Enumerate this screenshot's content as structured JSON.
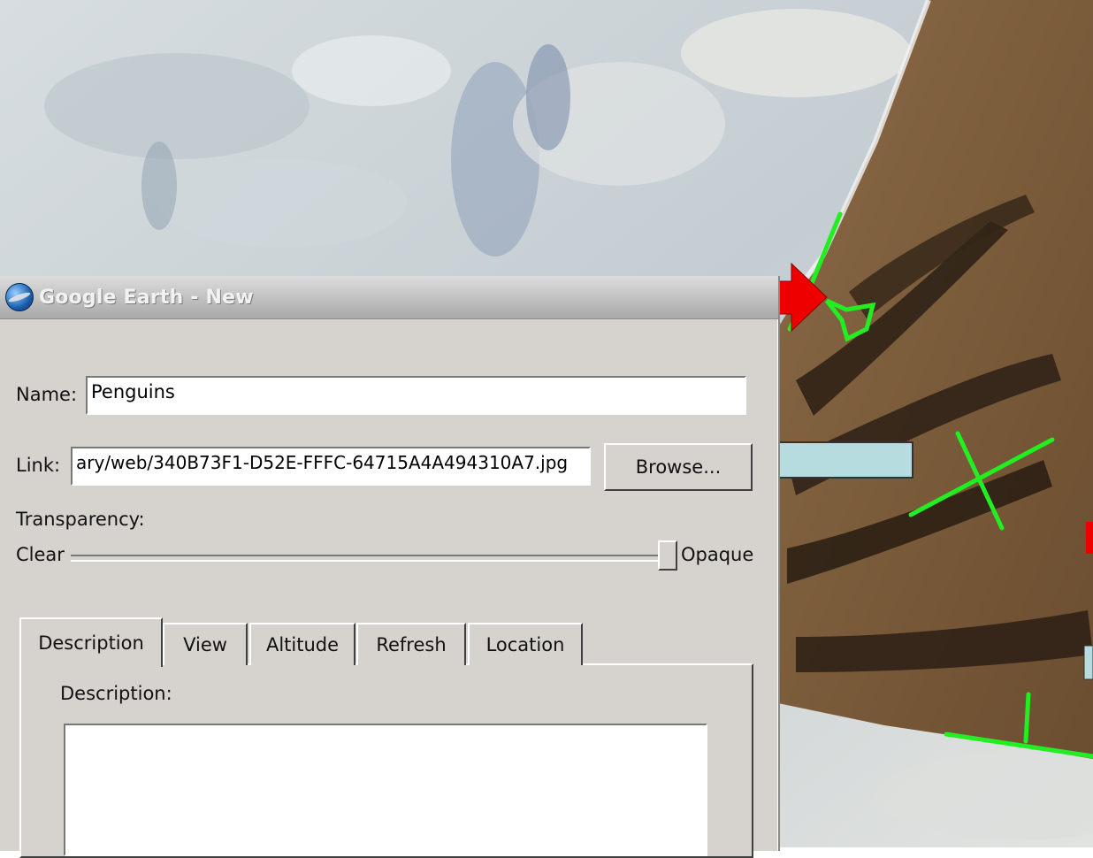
{
  "window": {
    "title": "Google Earth - New"
  },
  "form": {
    "name_label": "Name:",
    "name_value": "Penguins",
    "link_label": "Link:",
    "link_value": "ary/web/340B73F1-D52E-FFFC-64715A4A494310A7.jpg",
    "browse_label": "Browse...",
    "transparency_label": "Transparency:",
    "clear_label": "Clear",
    "opaque_label": "Opaque",
    "transparency_level": 1.0
  },
  "tabs": [
    {
      "label": "Description",
      "active": true
    },
    {
      "label": "View",
      "active": false
    },
    {
      "label": "Altitude",
      "active": false
    },
    {
      "label": "Refresh",
      "active": false
    },
    {
      "label": "Location",
      "active": false
    }
  ],
  "description": {
    "label": "Description:",
    "value": ""
  },
  "annotations": {
    "red_arrow_color": "#ee0000",
    "blue_arrow_color": "#b7dce0",
    "overlay_outline_color": "#22ee22"
  },
  "icons": {
    "app_icon": "google-earth-icon"
  }
}
